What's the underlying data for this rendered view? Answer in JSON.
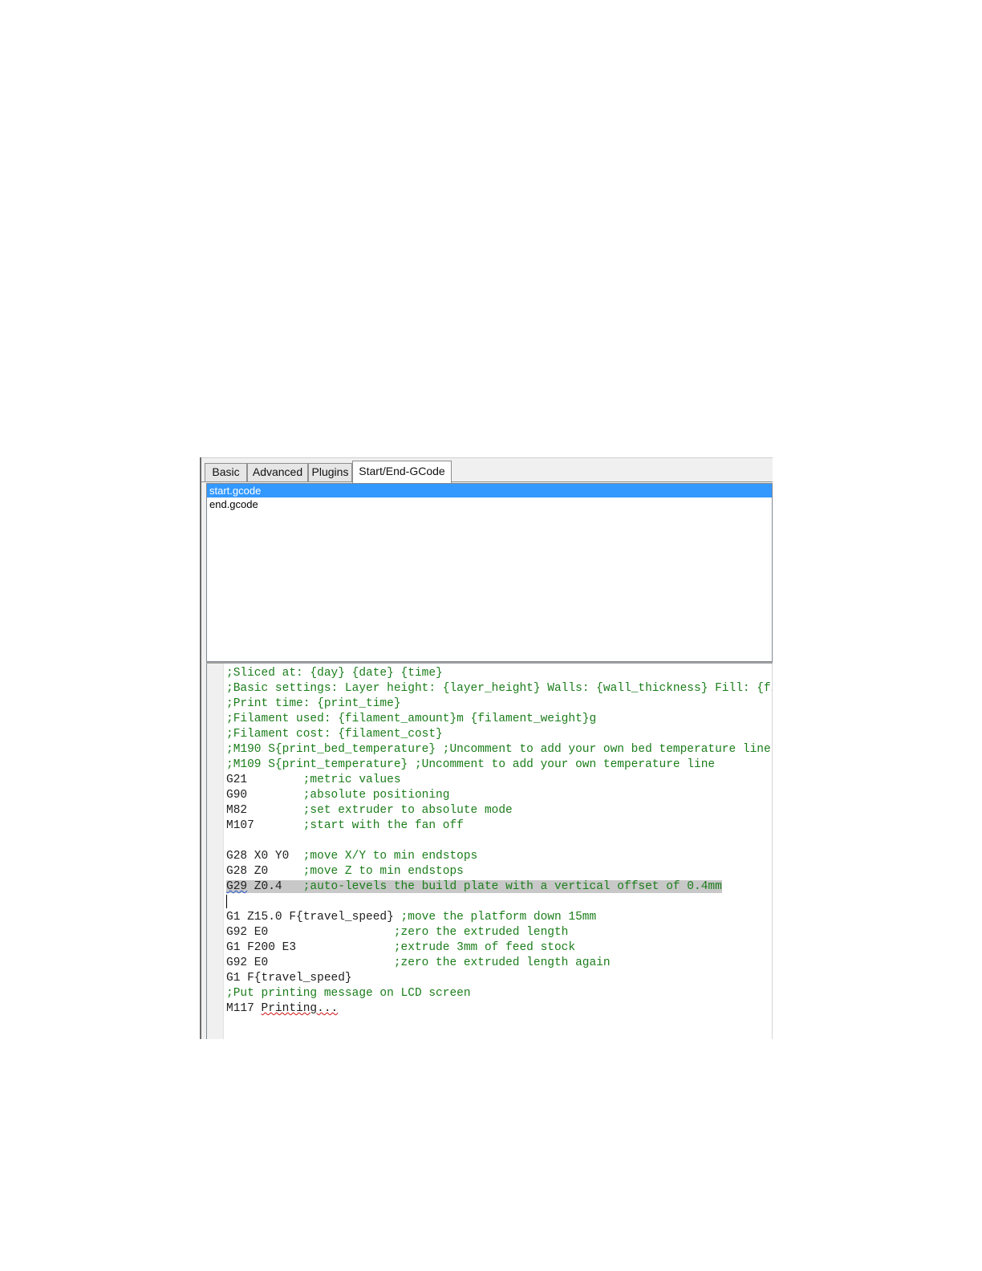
{
  "tabs": [
    {
      "label": "Basic",
      "active": false
    },
    {
      "label": "Advanced",
      "active": false
    },
    {
      "label": "Plugins",
      "active": false
    },
    {
      "label": "Start/End-GCode",
      "active": true
    }
  ],
  "files": [
    {
      "name": "start.gcode",
      "selected": true
    },
    {
      "name": "end.gcode",
      "selected": false
    }
  ],
  "code": [
    {
      "cmd": "",
      "comment": ";Sliced at: {day} {date} {time}"
    },
    {
      "cmd": "",
      "comment": ";Basic settings: Layer height: {layer_height} Walls: {wall_thickness} Fill: {fill_density}"
    },
    {
      "cmd": "",
      "comment": ";Print time: {print_time}"
    },
    {
      "cmd": "",
      "comment": ";Filament used: {filament_amount}m {filament_weight}g"
    },
    {
      "cmd": "",
      "comment": ";Filament cost: {filament_cost}"
    },
    {
      "cmd": "",
      "comment": ";M190 S{print_bed_temperature} ;Uncomment to add your own bed temperature line"
    },
    {
      "cmd": "",
      "comment": ";M109 S{print_temperature} ;Uncomment to add your own temperature line"
    },
    {
      "cmd": "G21        ",
      "comment": ";metric values"
    },
    {
      "cmd": "G90        ",
      "comment": ";absolute positioning"
    },
    {
      "cmd": "M82        ",
      "comment": ";set extruder to absolute mode"
    },
    {
      "cmd": "M107       ",
      "comment": ";start with the fan off"
    },
    {
      "cmd": "",
      "comment": ""
    },
    {
      "cmd": "G28 X0 Y0  ",
      "comment": ";move X/Y to min endstops"
    },
    {
      "cmd": "G28 Z0     ",
      "comment": ";move Z to min endstops"
    },
    {
      "cmd": "G29 Z0.4   ",
      "comment": ";auto-levels the build plate with a vertical offset of 0.4mm",
      "highlighted": true
    },
    {
      "cmd": "",
      "comment": "",
      "caret": true
    },
    {
      "cmd": "G1 Z15.0 F{travel_speed} ",
      "comment": ";move the platform down 15mm"
    },
    {
      "cmd": "G92 E0                  ",
      "comment": ";zero the extruded length"
    },
    {
      "cmd": "G1 F200 E3              ",
      "comment": ";extrude 3mm of feed stock"
    },
    {
      "cmd": "G92 E0                  ",
      "comment": ";zero the extruded length again"
    },
    {
      "cmd": "G1 F{travel_speed}",
      "comment": ""
    },
    {
      "cmd": "",
      "comment": ";Put printing message on LCD screen"
    },
    {
      "cmd": "M117 Printing...",
      "comment": ""
    }
  ]
}
